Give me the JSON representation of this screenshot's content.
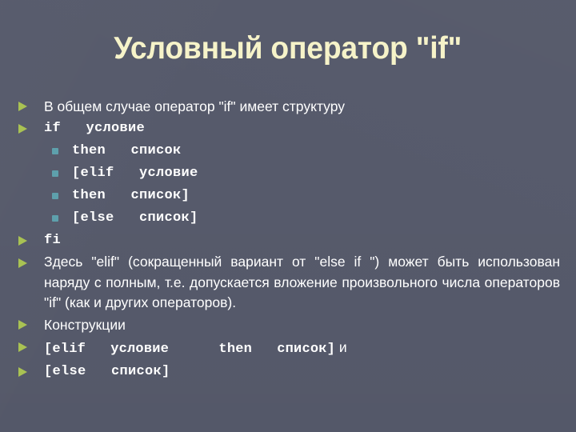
{
  "slide": {
    "title": "Условный оператор \"if\"",
    "theme": {
      "background": "#565a6b",
      "title_color": "#f6f3c9",
      "text_color": "#ffffff",
      "bullet_level1_color": "#a9c253",
      "bullet_level2_color": "#5ea0ac"
    },
    "bullets": [
      {
        "level": 1,
        "style": "prose",
        "marker": "triangle-bullet-icon",
        "text": "В общем случае оператор \"if\" имеет структуру"
      },
      {
        "level": 1,
        "style": "mono",
        "marker": "triangle-bullet-icon",
        "text": "if   условие"
      },
      {
        "level": 2,
        "style": "mono",
        "marker": "square-bullet-icon",
        "text": "then   список"
      },
      {
        "level": 2,
        "style": "mono",
        "marker": "square-bullet-icon",
        "text": "[elif   условие"
      },
      {
        "level": 2,
        "style": "mono",
        "marker": "square-bullet-icon",
        "text": "then   список]"
      },
      {
        "level": 2,
        "style": "mono",
        "marker": "square-bullet-icon",
        "text": "[else   список]"
      },
      {
        "level": 1,
        "style": "mono",
        "marker": "triangle-bullet-icon",
        "text": "fi"
      },
      {
        "level": 1,
        "style": "paragraph",
        "marker": "triangle-bullet-icon",
        "text": "Здесь \"elif\" (сокращенный вариант от \"else if \") может быть использован наряду с полным, т.е. допускается вложение произвольного числа операторов \"if\" (как и других операторов)."
      },
      {
        "level": 1,
        "style": "prose",
        "marker": "triangle-bullet-icon",
        "text": "Конструкции"
      },
      {
        "level": 1,
        "style": "mono-mixed",
        "marker": "triangle-bullet-icon",
        "text": "[elif   условие      then   список]",
        "suffix": " и"
      },
      {
        "level": 1,
        "style": "mono",
        "marker": "triangle-bullet-icon",
        "text": "[else   список]"
      }
    ]
  }
}
